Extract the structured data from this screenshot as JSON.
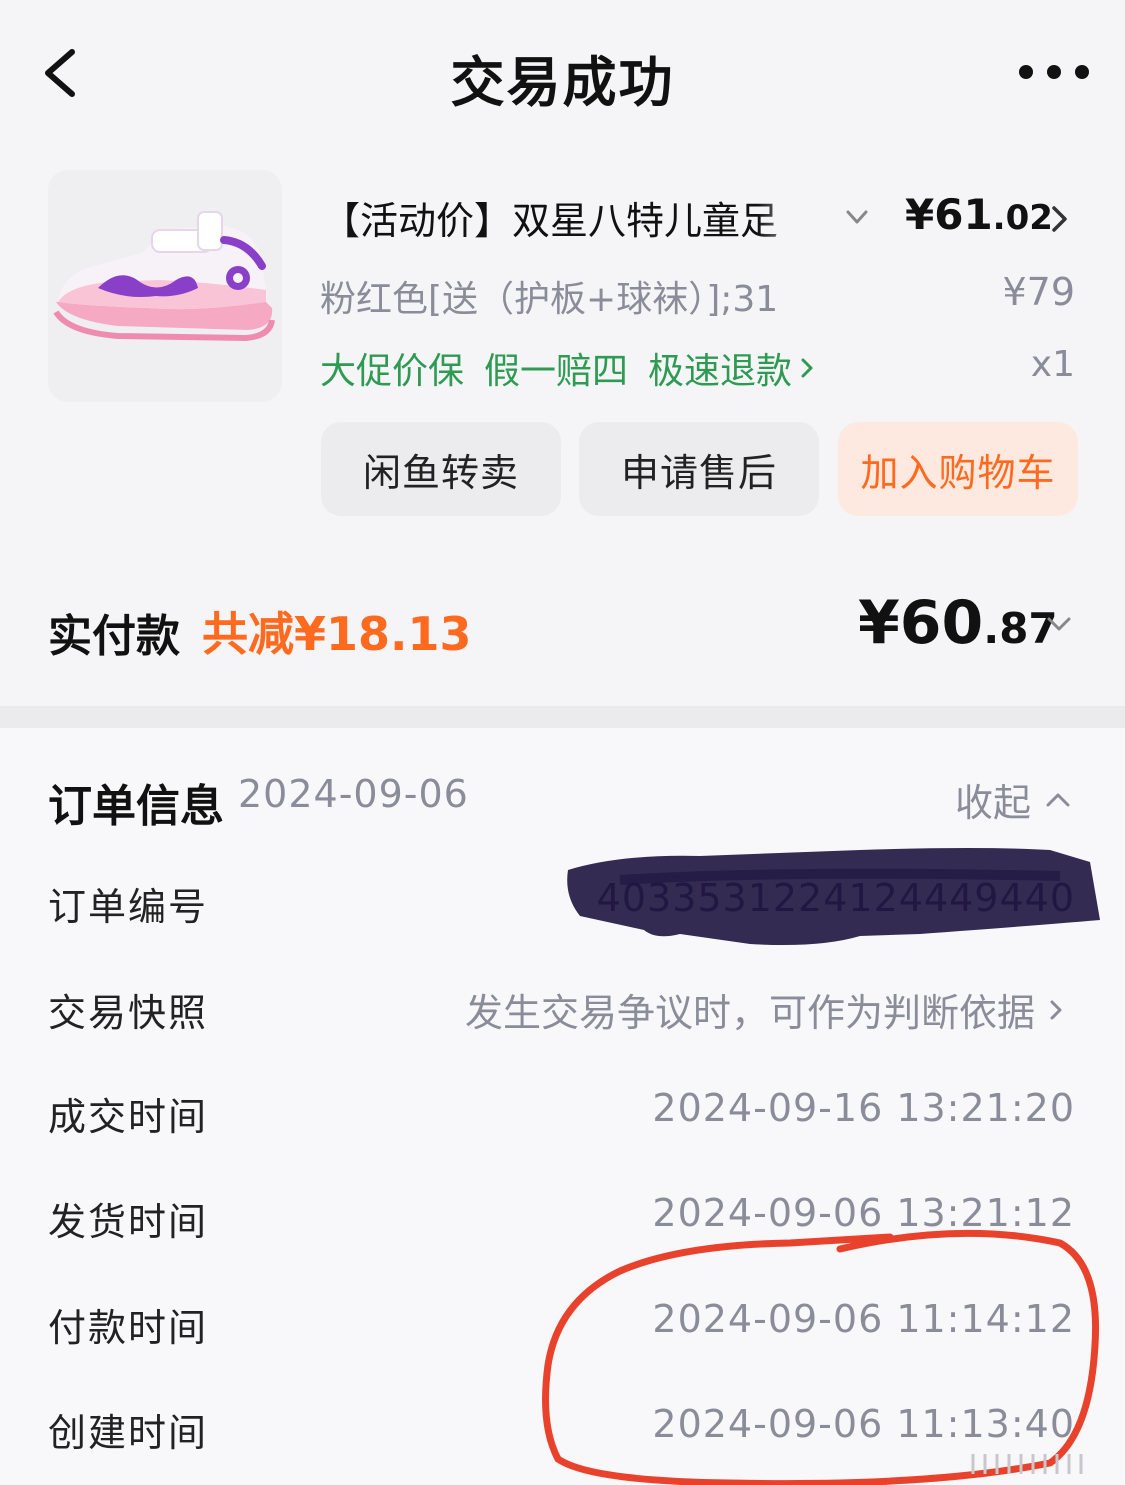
{
  "header": {
    "title": "交易成功"
  },
  "product": {
    "title": "【活动价】双星八特儿童足",
    "price_int": "¥61",
    "price_dec": ".02",
    "spec": "粉红色[送（护板+球袜）];31",
    "original_price": "¥79",
    "services": [
      "大促价保",
      "假一赔四",
      "极速退款"
    ],
    "quantity": "x1"
  },
  "actions": {
    "resell": "闲鱼转卖",
    "aftersale": "申请售后",
    "add_cart": "加入购物车"
  },
  "payment": {
    "label": "实付款",
    "discount": "共减¥18.13",
    "total_int": "¥60",
    "total_dec": ".87"
  },
  "order_info": {
    "title": "订单信息",
    "date": "2024-09-06",
    "collapse": "收起",
    "rows": [
      {
        "label": "订单编号",
        "value": "4033531224124449440"
      },
      {
        "label": "交易快照",
        "value": "发生交易争议时，可作为判断依据"
      },
      {
        "label": "成交时间",
        "value": "2024-09-16 13:21:20"
      },
      {
        "label": "发货时间",
        "value": "2024-09-06 13:21:12"
      },
      {
        "label": "付款时间",
        "value": "2024-09-06 11:14:12"
      },
      {
        "label": "创建时间",
        "value": "2024-09-06 11:13:40"
      }
    ]
  },
  "colors": {
    "accent_orange": "#ff6a1f",
    "service_green": "#2e9a52",
    "text_muted": "#8a8d99",
    "annotation_red": "#e8422c",
    "redaction": "#1e1440"
  }
}
